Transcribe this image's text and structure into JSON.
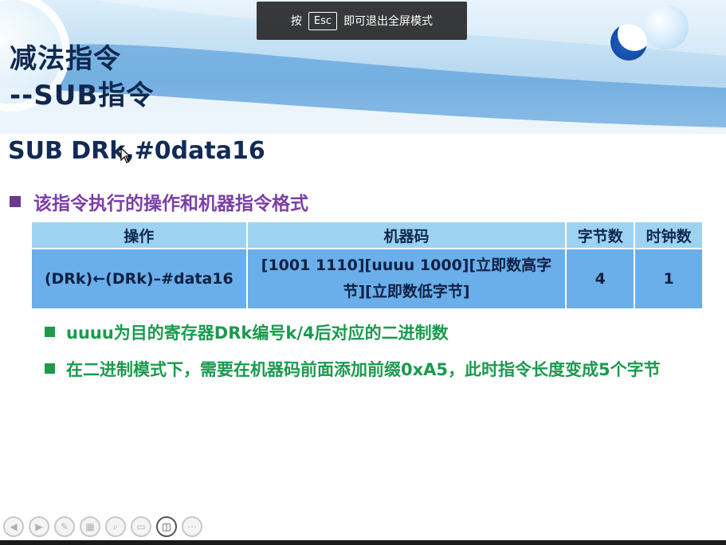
{
  "slide": {
    "title_line1": "减法指令",
    "title_line2": "--SUB指令",
    "instruction": "SUB DRk,#0data16",
    "bullet1": "该指令执行的操作和机器指令格式",
    "table": {
      "headers": [
        "操作",
        "机器码",
        "字节数",
        "时钟数"
      ],
      "row": {
        "operation": "(DRk)←(DRk)–#data16",
        "machine_code": "[1001 1110][uuuu 1000][立即数高字节][立即数低字节]",
        "bytes": "4",
        "clocks": "1"
      }
    },
    "sub_bullets": [
      "uuuu为目的寄存器DRk编号k/4后对应的二进制数",
      "在二进制模式下，需要在机器码前面添加前缀0xA5，此时指令长度变成5个字节"
    ]
  },
  "fullscreen_hint": {
    "prefix": "按",
    "key": "Esc",
    "suffix": "即可退出全屏模式"
  },
  "toolbar": {
    "buttons": [
      {
        "icon": "prev-icon"
      },
      {
        "icon": "next-icon"
      },
      {
        "icon": "pen-icon"
      },
      {
        "icon": "slides-icon"
      },
      {
        "icon": "zoom-icon"
      },
      {
        "icon": "screen-icon"
      },
      {
        "icon": "camera-icon"
      },
      {
        "icon": "more-icon"
      }
    ]
  },
  "colors": {
    "title": "#10284e",
    "bullet_purple": "#7b3fa8",
    "bullet_green": "#1a9a4e",
    "table_header": "#9dd3f1",
    "table_cell": "#6aaeea"
  }
}
